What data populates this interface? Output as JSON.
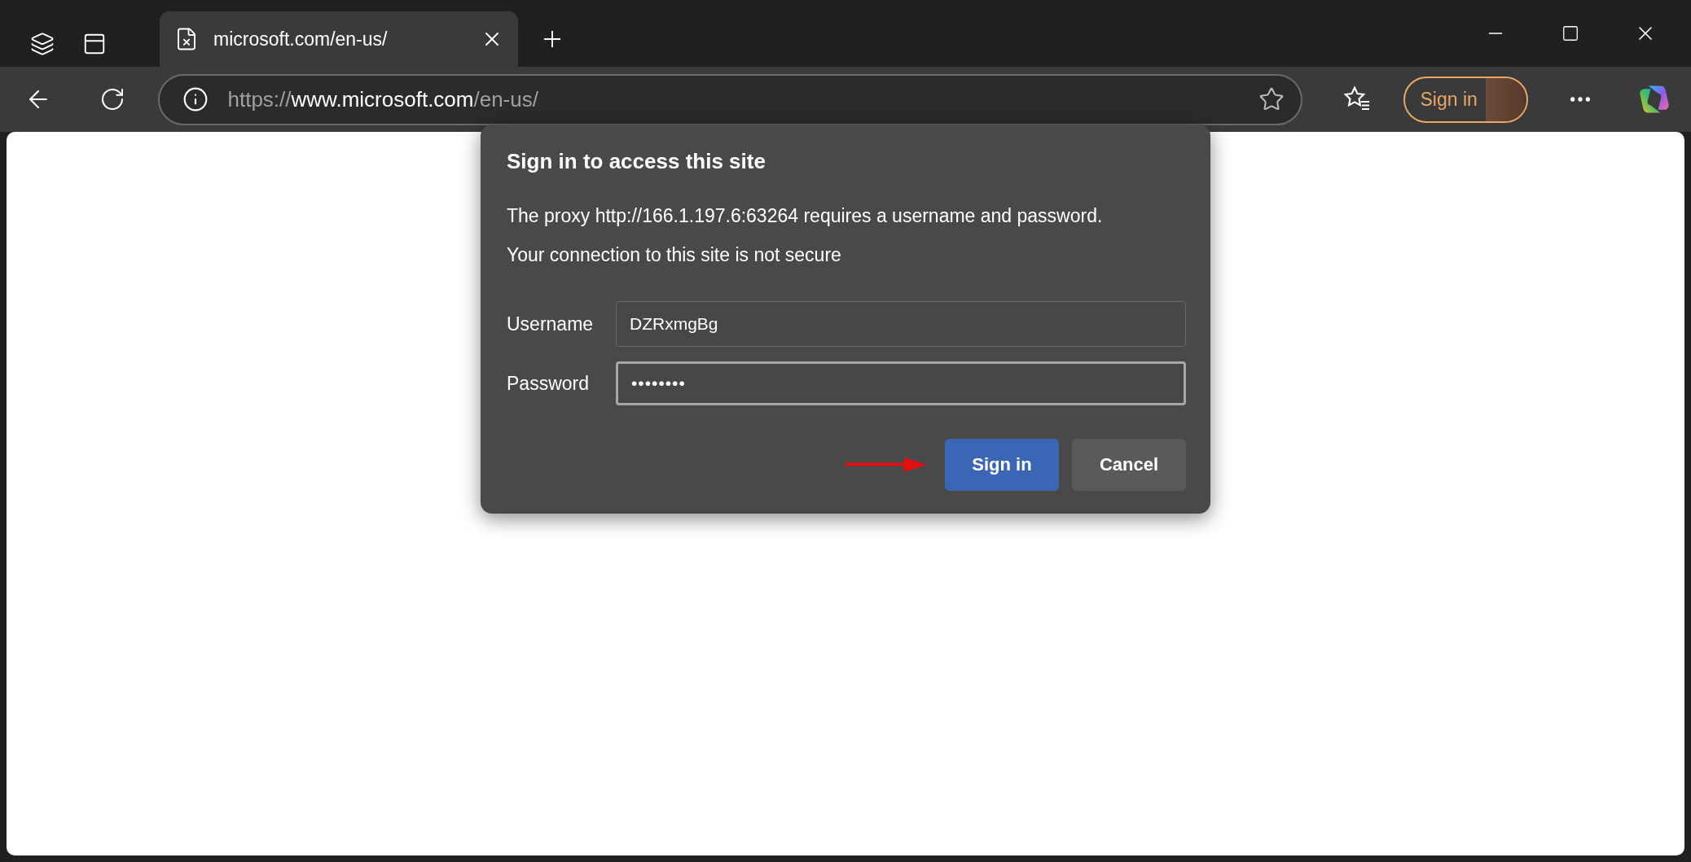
{
  "browser": {
    "tab": {
      "title": "microsoft.com/en-us/",
      "selected": true
    },
    "address": {
      "scheme": "https://",
      "host": "www.microsoft.com",
      "path": "/en-us/"
    },
    "profile_button": "Sign in"
  },
  "dialog": {
    "title": "Sign in to access this site",
    "messages": [
      "The proxy http://166.1.197.6:63264 requires a username and password.",
      "Your connection to this site is not secure"
    ],
    "fields": [
      {
        "label": "Username",
        "kind": "text",
        "value": "DZRxmgBg",
        "focused": false
      },
      {
        "label": "Password",
        "kind": "password",
        "value": "••••••••",
        "focused": true
      }
    ],
    "buttons": [
      {
        "label": "Sign in",
        "kind": "primary"
      },
      {
        "label": "Cancel",
        "kind": "secondary"
      }
    ]
  }
}
